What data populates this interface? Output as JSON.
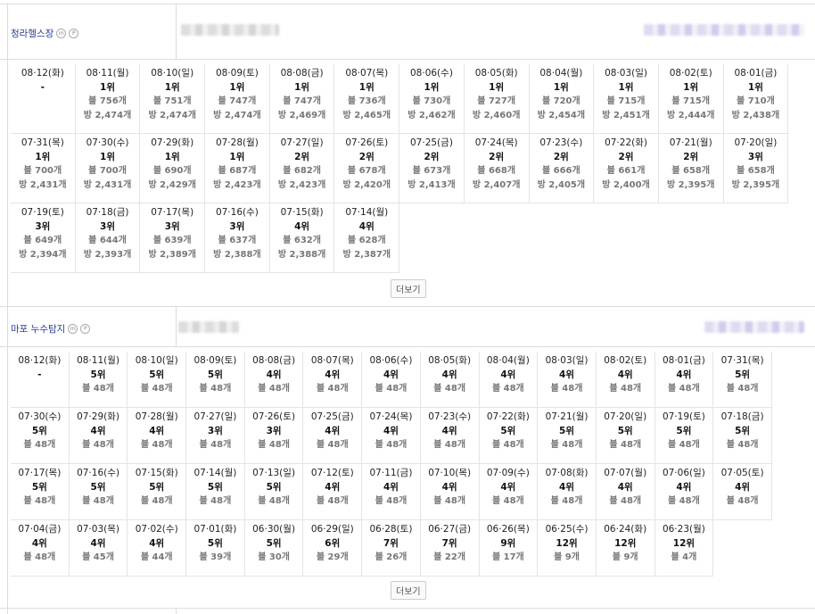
{
  "sections": [
    {
      "name": "청라헬스장",
      "badges": [
        "m",
        "P"
      ],
      "more_label": "더보기",
      "entries": [
        {
          "date": "08·12(화)",
          "rank": "-",
          "blog": "",
          "room": ""
        },
        {
          "date": "08·11(월)",
          "rank": "1위",
          "blog": "블 756개",
          "room": "방 2,474개"
        },
        {
          "date": "08·10(일)",
          "rank": "1위",
          "blog": "블 751개",
          "room": "방 2,474개"
        },
        {
          "date": "08·09(토)",
          "rank": "1위",
          "blog": "블 747개",
          "room": "방 2,474개"
        },
        {
          "date": "08·08(금)",
          "rank": "1위",
          "blog": "블 747개",
          "room": "방 2,469개"
        },
        {
          "date": "08·07(목)",
          "rank": "1위",
          "blog": "블 736개",
          "room": "방 2,465개"
        },
        {
          "date": "08·06(수)",
          "rank": "1위",
          "blog": "블 730개",
          "room": "방 2,462개"
        },
        {
          "date": "08·05(화)",
          "rank": "1위",
          "blog": "블 727개",
          "room": "방 2,460개"
        },
        {
          "date": "08·04(월)",
          "rank": "1위",
          "blog": "블 720개",
          "room": "방 2,454개"
        },
        {
          "date": "08·03(일)",
          "rank": "1위",
          "blog": "블 715개",
          "room": "방 2,451개"
        },
        {
          "date": "08·02(토)",
          "rank": "1위",
          "blog": "블 715개",
          "room": "방 2,444개"
        },
        {
          "date": "08·01(금)",
          "rank": "1위",
          "blog": "블 710개",
          "room": "방 2,438개"
        },
        {
          "date": "07·31(목)",
          "rank": "1위",
          "blog": "블 700개",
          "room": "방 2,431개"
        },
        {
          "date": "07·30(수)",
          "rank": "1위",
          "blog": "블 700개",
          "room": "방 2,431개"
        },
        {
          "date": "07·29(화)",
          "rank": "1위",
          "blog": "블 690개",
          "room": "방 2,429개"
        },
        {
          "date": "07·28(월)",
          "rank": "1위",
          "blog": "블 687개",
          "room": "방 2,423개"
        },
        {
          "date": "07·27(일)",
          "rank": "2위",
          "blog": "블 682개",
          "room": "방 2,423개"
        },
        {
          "date": "07·26(토)",
          "rank": "2위",
          "blog": "블 678개",
          "room": "방 2,420개"
        },
        {
          "date": "07·25(금)",
          "rank": "2위",
          "blog": "블 673개",
          "room": "방 2,413개"
        },
        {
          "date": "07·24(목)",
          "rank": "2위",
          "blog": "블 668개",
          "room": "방 2,407개"
        },
        {
          "date": "07·23(수)",
          "rank": "2위",
          "blog": "블 666개",
          "room": "방 2,405개"
        },
        {
          "date": "07·22(화)",
          "rank": "2위",
          "blog": "블 661개",
          "room": "방 2,400개"
        },
        {
          "date": "07·21(월)",
          "rank": "2위",
          "blog": "블 658개",
          "room": "방 2,395개"
        },
        {
          "date": "07·20(일)",
          "rank": "3위",
          "blog": "블 658개",
          "room": "방 2,395개"
        },
        {
          "date": "07·19(토)",
          "rank": "3위",
          "blog": "블 649개",
          "room": "방 2,394개"
        },
        {
          "date": "07·18(금)",
          "rank": "3위",
          "blog": "블 644개",
          "room": "방 2,393개"
        },
        {
          "date": "07·17(목)",
          "rank": "3위",
          "blog": "블 639개",
          "room": "방 2,389개"
        },
        {
          "date": "07·16(수)",
          "rank": "3위",
          "blog": "블 637개",
          "room": "방 2,388개"
        },
        {
          "date": "07·15(화)",
          "rank": "4위",
          "blog": "블 632개",
          "room": "방 2,388개"
        },
        {
          "date": "07·14(월)",
          "rank": "4위",
          "blog": "블 628개",
          "room": "방 2,387개"
        }
      ]
    },
    {
      "name": "마포 누수탐지",
      "badges": [
        "m",
        "P"
      ],
      "more_label": "더보기",
      "entries": [
        {
          "date": "08·12(화)",
          "rank": "-",
          "blog": ""
        },
        {
          "date": "08·11(월)",
          "rank": "5위",
          "blog": "블 48개"
        },
        {
          "date": "08·10(일)",
          "rank": "5위",
          "blog": "블 48개"
        },
        {
          "date": "08·09(토)",
          "rank": "5위",
          "blog": "블 48개"
        },
        {
          "date": "08·08(금)",
          "rank": "4위",
          "blog": "블 48개"
        },
        {
          "date": "08·07(목)",
          "rank": "4위",
          "blog": "블 48개"
        },
        {
          "date": "08·06(수)",
          "rank": "4위",
          "blog": "블 48개"
        },
        {
          "date": "08·05(화)",
          "rank": "4위",
          "blog": "블 48개"
        },
        {
          "date": "08·04(월)",
          "rank": "4위",
          "blog": "블 48개"
        },
        {
          "date": "08·03(일)",
          "rank": "4위",
          "blog": "블 48개"
        },
        {
          "date": "08·02(토)",
          "rank": "4위",
          "blog": "블 48개"
        },
        {
          "date": "08·01(금)",
          "rank": "4위",
          "blog": "블 48개"
        },
        {
          "date": "07·31(목)",
          "rank": "5위",
          "blog": "블 48개"
        },
        {
          "date": "07·30(수)",
          "rank": "5위",
          "blog": "블 48개"
        },
        {
          "date": "07·29(화)",
          "rank": "4위",
          "blog": "블 48개"
        },
        {
          "date": "07·28(월)",
          "rank": "4위",
          "blog": "블 48개"
        },
        {
          "date": "07·27(일)",
          "rank": "3위",
          "blog": "블 48개"
        },
        {
          "date": "07·26(토)",
          "rank": "3위",
          "blog": "블 48개"
        },
        {
          "date": "07·25(금)",
          "rank": "4위",
          "blog": "블 48개"
        },
        {
          "date": "07·24(목)",
          "rank": "4위",
          "blog": "블 48개"
        },
        {
          "date": "07·23(수)",
          "rank": "4위",
          "blog": "블 48개"
        },
        {
          "date": "07·22(화)",
          "rank": "5위",
          "blog": "블 48개"
        },
        {
          "date": "07·21(월)",
          "rank": "5위",
          "blog": "블 48개"
        },
        {
          "date": "07·20(일)",
          "rank": "5위",
          "blog": "블 48개"
        },
        {
          "date": "07·19(토)",
          "rank": "5위",
          "blog": "블 48개"
        },
        {
          "date": "07·18(금)",
          "rank": "5위",
          "blog": "블 48개"
        },
        {
          "date": "07·17(목)",
          "rank": "5위",
          "blog": "블 48개"
        },
        {
          "date": "07·16(수)",
          "rank": "5위",
          "blog": "블 48개"
        },
        {
          "date": "07·15(화)",
          "rank": "5위",
          "blog": "블 48개"
        },
        {
          "date": "07·14(월)",
          "rank": "5위",
          "blog": "블 48개"
        },
        {
          "date": "07·13(일)",
          "rank": "5위",
          "blog": "블 48개"
        },
        {
          "date": "07·12(토)",
          "rank": "4위",
          "blog": "블 48개"
        },
        {
          "date": "07·11(금)",
          "rank": "4위",
          "blog": "블 48개"
        },
        {
          "date": "07·10(목)",
          "rank": "4위",
          "blog": "블 48개"
        },
        {
          "date": "07·09(수)",
          "rank": "4위",
          "blog": "블 48개"
        },
        {
          "date": "07·08(화)",
          "rank": "4위",
          "blog": "블 48개"
        },
        {
          "date": "07·07(월)",
          "rank": "4위",
          "blog": "블 48개"
        },
        {
          "date": "07·06(일)",
          "rank": "4위",
          "blog": "블 48개"
        },
        {
          "date": "07·05(토)",
          "rank": "4위",
          "blog": "블 48개"
        },
        {
          "date": "07·04(금)",
          "rank": "4위",
          "blog": "블 48개"
        },
        {
          "date": "07·03(목)",
          "rank": "4위",
          "blog": "블 45개"
        },
        {
          "date": "07·02(수)",
          "rank": "4위",
          "blog": "블 44개"
        },
        {
          "date": "07·01(화)",
          "rank": "5위",
          "blog": "블 39개"
        },
        {
          "date": "06·30(월)",
          "rank": "5위",
          "blog": "블 30개"
        },
        {
          "date": "06·29(일)",
          "rank": "6위",
          "blog": "블 29개"
        },
        {
          "date": "06·28(토)",
          "rank": "7위",
          "blog": "블 26개"
        },
        {
          "date": "06·27(금)",
          "rank": "7위",
          "blog": "블 22개"
        },
        {
          "date": "06·26(목)",
          "rank": "9위",
          "blog": "블 17개"
        },
        {
          "date": "06·25(수)",
          "rank": "12위",
          "blog": "블 9개"
        },
        {
          "date": "06·24(화)",
          "rank": "12위",
          "blog": "블 9개"
        },
        {
          "date": "06·23(월)",
          "rank": "12위",
          "blog": "블 4개"
        }
      ]
    }
  ]
}
